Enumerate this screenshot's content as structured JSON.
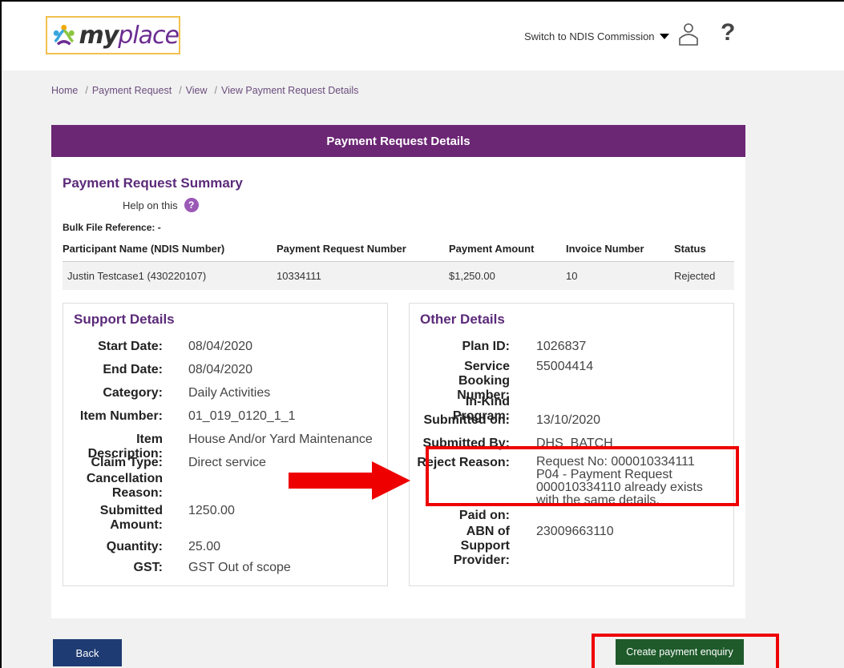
{
  "header": {
    "logo_my": "my",
    "logo_place": "place",
    "switch_label": "Switch to NDIS Commission",
    "help_glyph": "?"
  },
  "breadcrumb": [
    "Home",
    "Payment Request",
    "View",
    "View Payment Request Details"
  ],
  "card": {
    "title": "Payment Request Details",
    "summary_title": "Payment Request Summary",
    "help_label": "Help on this",
    "help_glyph": "?",
    "bulk_ref": "Bulk File Reference: -",
    "table": {
      "columns": [
        "Participant Name (NDIS Number)",
        "Payment Request Number",
        "Payment Amount",
        "Invoice Number",
        "Status"
      ],
      "rows": [
        [
          "Justin Testcase1 (430220107)",
          "10334111",
          "$1,250.00",
          "10",
          "Rejected"
        ]
      ]
    }
  },
  "support": {
    "title": "Support Details",
    "fields": [
      {
        "label": "Start Date:",
        "value": "08/04/2020"
      },
      {
        "label": "End Date:",
        "value": "08/04/2020"
      },
      {
        "label": "Category:",
        "value": "Daily Activities"
      },
      {
        "label": "Item Number:",
        "value": "01_019_0120_1_1"
      },
      {
        "label": "Item Description:",
        "value": "House And/or Yard Maintenance"
      },
      {
        "label": "Claim Type:",
        "value": "Direct service"
      },
      {
        "label": "Cancellation Reason:",
        "value": ""
      },
      {
        "label": "Submitted Amount:",
        "value": "1250.00"
      },
      {
        "label": "Quantity:",
        "value": "25.00"
      },
      {
        "label": "GST:",
        "value": "GST Out of scope"
      }
    ]
  },
  "other": {
    "title": "Other Details",
    "fields": [
      {
        "label": "Plan ID:",
        "value": "1026837"
      },
      {
        "label": "Service Booking Number:",
        "value": "55004414"
      },
      {
        "label": "In-Kind Program:",
        "value": ""
      },
      {
        "label": "Submitted on:",
        "value": "13/10/2020"
      },
      {
        "label": "Submitted By:",
        "value": "DHS_BATCH"
      },
      {
        "label": "Reject Reason:",
        "value": "Request No: 000010334111 P04 - Payment Request 000010334110 already exists with the same details."
      },
      {
        "label": "Paid on:",
        "value": ""
      },
      {
        "label": "ABN of Support Provider:",
        "value": "23009663110"
      }
    ]
  },
  "buttons": {
    "back": "Back",
    "enquiry": "Create payment enquiry"
  },
  "colors": {
    "brand_purple": "#6b2674",
    "highlight_red": "#ee0000",
    "back_blue": "#1f3b73",
    "enquiry_green": "#1e5a2a"
  }
}
